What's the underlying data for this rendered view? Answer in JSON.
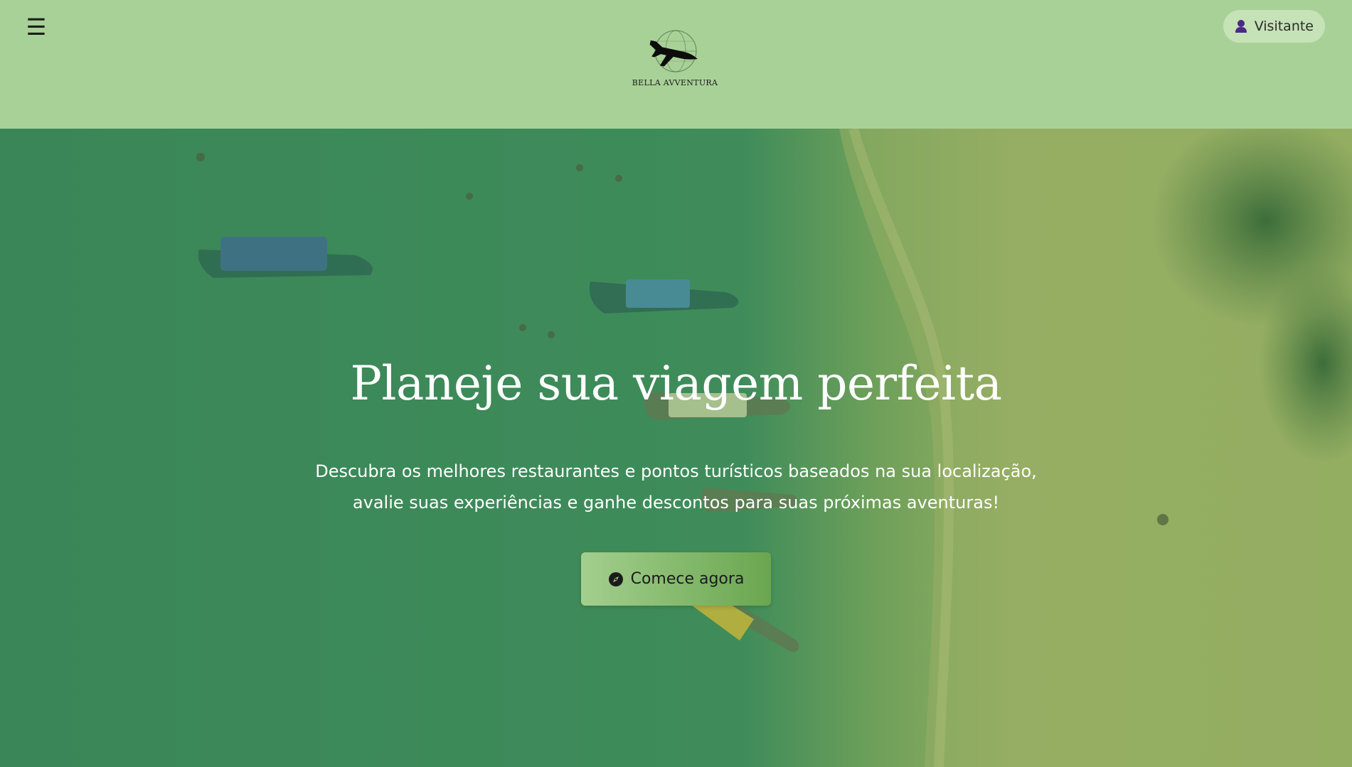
{
  "header": {
    "menu_icon": "hamburger-menu-icon",
    "logo_text": "BELLA AVVENTURA",
    "visitor_label": "Visitante",
    "visitor_icon": "user-icon",
    "background_color": "#a8d197"
  },
  "hero": {
    "title": "Planeje sua viagem perfeita",
    "description_line1": "Descubra os melhores restaurantes e pontos turísticos baseados na sua localização,",
    "description_line2": "avalie suas experiências e ganhe descontos para suas próximas aventuras!",
    "cta_label": "Comece agora",
    "cta_icon": "compass-icon",
    "overlay_color": "#3f8a5c"
  }
}
